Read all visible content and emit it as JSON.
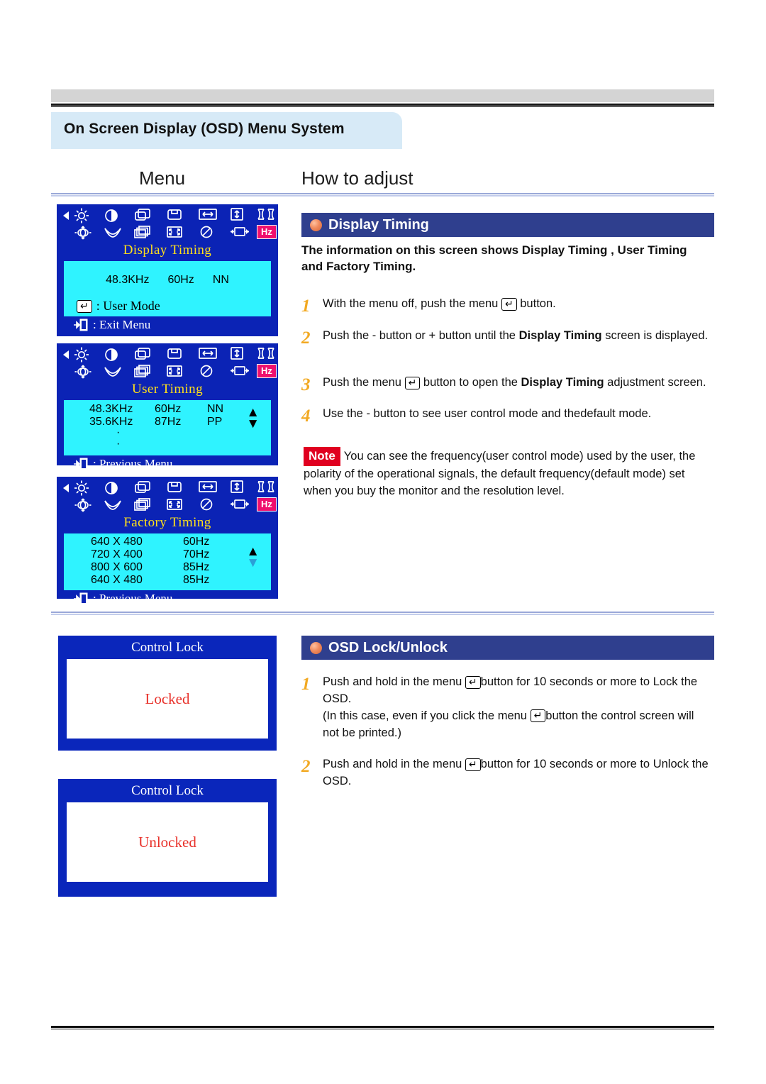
{
  "page": {
    "title": "On Screen Display (OSD) Menu System",
    "column_headers": {
      "menu": "Menu",
      "how": "How to adjust"
    }
  },
  "colors": {
    "osd_blue": "#0b23b5",
    "osd_screen_cyan": "#2ff3ff",
    "osd_title_yellow": "#ffe01a",
    "hz_highlight": "#ef0f6e",
    "section_header": "#2f3f8e",
    "step_number": "#f2a922",
    "note_tag": "#e00020",
    "lock_state_red": "#e8312a",
    "title_band": "#d7eaf7"
  },
  "osd_icons": {
    "row1": [
      "brightness-icon",
      "contrast-icon",
      "h-position-icon",
      "v-position-icon",
      "h-size-icon",
      "v-size-icon",
      "pincushion-icon"
    ],
    "row2": [
      "rotation-icon",
      "trapezoid-icon",
      "parallelogram-icon",
      "corner-correction-icon",
      "degauss-icon",
      "zoom-icon",
      "hz-timing-icon"
    ],
    "left_arrow": "nav-left-arrow-icon",
    "right_arrow": "nav-right-arrow-icon",
    "selected_label": "Hz"
  },
  "osd_panels": [
    {
      "id": "display-timing",
      "title": "Display Timing",
      "rows": [
        [
          "48.3KHz",
          "60Hz",
          "NN"
        ]
      ],
      "scroll_arrows": false,
      "inner_lines": [
        {
          "glyph": "menu-key-icon",
          "text": ": User Mode"
        }
      ],
      "footer": {
        "glyph": "exit-door-icon",
        "text": ": Exit Menu"
      }
    },
    {
      "id": "user-timing",
      "title": "User Timing",
      "rows": [
        [
          "48.3KHz",
          "60Hz",
          "NN"
        ],
        [
          "35.6KHz",
          "87Hz",
          "PP"
        ],
        [
          "·",
          "",
          ""
        ],
        [
          "·",
          "",
          ""
        ]
      ],
      "scroll_arrows": true,
      "arrow_up": "▲",
      "arrow_down": "▼",
      "footer": {
        "glyph": "exit-door-icon",
        "text": ": Previous Menu"
      }
    },
    {
      "id": "factory-timing",
      "title": "Factory Timing",
      "rows": [
        [
          "640 X 480",
          "60Hz"
        ],
        [
          "720 X 400",
          "70Hz"
        ],
        [
          "800 X 600",
          "85Hz"
        ],
        [
          "640 X 480",
          "85Hz"
        ]
      ],
      "scroll_arrows": true,
      "arrow_up": "▲",
      "arrow_down": "▼",
      "footer": {
        "glyph": "exit-door-icon",
        "text": ": Previous Menu"
      }
    }
  ],
  "lock_boxes": [
    {
      "id": "locked",
      "title": "Control Lock",
      "state": "Locked"
    },
    {
      "id": "unlocked",
      "title": "Control Lock",
      "state": "Unlocked"
    }
  ],
  "sections": [
    {
      "id": "display-timing",
      "header": "Display Timing",
      "lead": "The information on this screen shows Display Timing , User Timing and Factory Timing.",
      "steps": [
        {
          "num": "1",
          "pre": "With the menu off, push the menu ",
          "key": "menu-key-icon",
          "post": " button."
        },
        {
          "num": "2",
          "pre": "Push the - button or  + button until the ",
          "strong": "Display Timing",
          "post": " screen is displayed."
        },
        {
          "num": "3",
          "pre": "Push the menu ",
          "key": "menu-key-icon",
          "mid": " button to open the ",
          "strong": "Display Timing",
          "post": " adjustment screen."
        },
        {
          "num": "4",
          "pre": "Use the - button to see user control mode and thedefault mode."
        }
      ],
      "note": {
        "tag": "Note",
        "text": "You can see the frequency(user control mode) used by the user, the polarity of the operational signals, the default frequency(default mode) set when you buy the monitor and the resolution level."
      }
    },
    {
      "id": "osd-lock-unlock",
      "header": "OSD Lock/Unlock",
      "steps": [
        {
          "num": "1",
          "pre": "Push and hold in the menu ",
          "key": "menu-key-icon",
          "post": "button for 10 seconds or more to Lock  the OSD.",
          "pre2": "(In this case, even if you click the menu ",
          "key2": "menu-key-icon",
          "post2": "button the control screen will not be printed.)"
        },
        {
          "num": "2",
          "pre": "Push and hold in the menu ",
          "key": "menu-key-icon",
          "post": "button for 10 seconds or more to Unlock the OSD."
        }
      ]
    }
  ]
}
